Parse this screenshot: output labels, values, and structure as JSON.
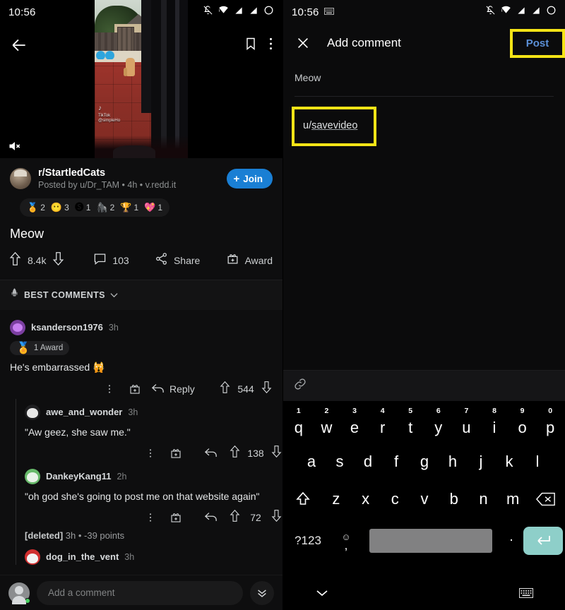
{
  "left": {
    "status": {
      "time": "10:56",
      "icons": [
        "bell-muted-icon",
        "wifi-icon",
        "signal-icon",
        "signal-x-icon",
        "battery-circle-icon"
      ]
    },
    "topbar": {
      "back": "back-arrow-icon",
      "save": "bookmark-icon",
      "more": "overflow-menu-icon"
    },
    "video": {
      "muted": true,
      "watermark_app": "TikTok",
      "watermark_user": "@simpleHo"
    },
    "post": {
      "subreddit": "r/StartledCats",
      "byline": "Posted by u/Dr_TAM • 4h • v.redd.it",
      "join_label": "Join",
      "title": "Meow",
      "awards": [
        {
          "icon": "🏅",
          "count": "2"
        },
        {
          "icon": "😶",
          "count": "3"
        },
        {
          "icon": "🅢",
          "count": "1"
        },
        {
          "icon": "🦍",
          "count": "2"
        },
        {
          "icon": "🏆",
          "count": "1"
        },
        {
          "icon": "💖",
          "count": "1"
        }
      ],
      "upvotes": "8.4k",
      "comments_count": "103",
      "share_label": "Share",
      "award_label": "Award"
    },
    "sort": {
      "label": "BEST COMMENTS"
    },
    "comments": [
      {
        "user": "ksanderson1976",
        "time": "3h",
        "avatar": "av-purple",
        "award_chip": "1 Award",
        "body": "He's embarrassed 🙀",
        "reply_label": "Reply",
        "score": "544",
        "indent": 0
      },
      {
        "user": "awe_and_wonder",
        "time": "3h",
        "avatar": "av-white",
        "body": "\"Aw geez, she saw me.\"",
        "score": "138",
        "indent": 1
      },
      {
        "user": "DankeyKang11",
        "time": "2h",
        "avatar": "av-green",
        "body": "\"oh god she's going to post me on that website again\"",
        "score": "72",
        "indent": 1
      }
    ],
    "deleted_comment": {
      "name": "[deleted]",
      "meta": "3h • -39 points"
    },
    "last_comment": {
      "user": "dog_in_the_vent",
      "time": "3h",
      "avatar": "av-red"
    },
    "bottom": {
      "placeholder": "Add a comment",
      "scroll_icon": "double-chevron-down-icon"
    }
  },
  "right": {
    "status": {
      "time": "10:56",
      "keyboard_icon": "keyboard-icon",
      "icons": [
        "bell-muted-icon",
        "wifi-icon",
        "signal-icon",
        "signal-x-icon",
        "battery-circle-icon"
      ]
    },
    "header": {
      "close": "close-icon",
      "title": "Add comment",
      "post_label": "Post"
    },
    "parent_text": "Meow",
    "editor": {
      "value_prefix": "u/",
      "value_underlined": "savevideo"
    },
    "toolbar": {
      "link_icon": "link-icon"
    },
    "keyboard": {
      "row1": [
        {
          "num": "1",
          "key": "q"
        },
        {
          "num": "2",
          "key": "w"
        },
        {
          "num": "3",
          "key": "e"
        },
        {
          "num": "4",
          "key": "r"
        },
        {
          "num": "5",
          "key": "t"
        },
        {
          "num": "6",
          "key": "y"
        },
        {
          "num": "7",
          "key": "u"
        },
        {
          "num": "8",
          "key": "i"
        },
        {
          "num": "9",
          "key": "o"
        },
        {
          "num": "0",
          "key": "p"
        }
      ],
      "row2": [
        "a",
        "s",
        "d",
        "f",
        "g",
        "h",
        "j",
        "k",
        "l"
      ],
      "row3": [
        "z",
        "x",
        "c",
        "v",
        "b",
        "n",
        "m"
      ],
      "shift_icon": "shift-icon",
      "backspace_icon": "backspace-icon",
      "symbols_label": "?123",
      "emoji_icon": "emoji-icon",
      "comma": ",",
      "period": ".",
      "enter_icon": "enter-icon",
      "nav_back_icon": "chevron-down-icon",
      "nav_keyboard_icon": "keyboard-icon"
    }
  },
  "colors": {
    "accent_blue": "#1a7fd4",
    "post_blue": "#5b8fd6",
    "highlight_yellow": "#f5e416",
    "enter_teal": "#8ecfc9"
  }
}
